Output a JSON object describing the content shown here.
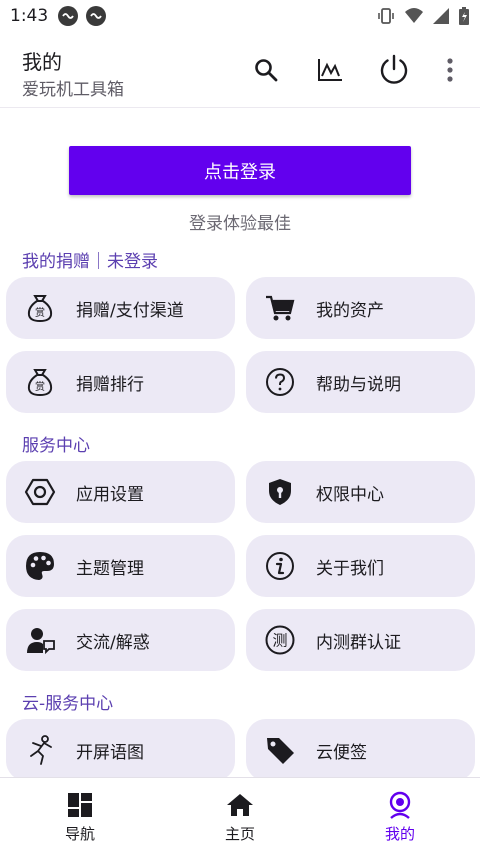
{
  "status_bar": {
    "time": "1:43"
  },
  "app_bar": {
    "title": "我的",
    "subtitle": "爱玩机工具箱",
    "actions": [
      "search-icon",
      "chart-icon",
      "power-icon",
      "more-vert-icon"
    ]
  },
  "login": {
    "button_label": "点击登录",
    "hint": "登录体验最佳",
    "accent_color": "#6200ee"
  },
  "sections": {
    "donate": {
      "title": "我的捐赠｜未登录",
      "items": [
        {
          "label": "捐赠/支付渠道",
          "icon": "money-bag-icon"
        },
        {
          "label": "我的资产",
          "icon": "cart-icon"
        },
        {
          "label": "捐赠排行",
          "icon": "money-bag-icon"
        },
        {
          "label": "帮助与说明",
          "icon": "help-circle-icon"
        }
      ]
    },
    "service": {
      "title": "服务中心",
      "items": [
        {
          "label": "应用设置",
          "icon": "settings-hexagon-icon"
        },
        {
          "label": "权限中心",
          "icon": "shield-icon"
        },
        {
          "label": "主题管理",
          "icon": "palette-icon"
        },
        {
          "label": "关于我们",
          "icon": "info-icon"
        },
        {
          "label": "交流/解惑",
          "icon": "chat-person-icon"
        },
        {
          "label": "内测群认证",
          "icon": "test-badge-icon"
        }
      ]
    },
    "cloud": {
      "title": "云-服务中心",
      "items": [
        {
          "label": "开屏语图",
          "icon": "dancer-icon"
        },
        {
          "label": "云便签",
          "icon": "tag-icon"
        }
      ]
    }
  },
  "bottom_nav": {
    "items": [
      {
        "label": "导航",
        "icon": "dashboard-icon"
      },
      {
        "label": "主页",
        "icon": "home-icon"
      },
      {
        "label": "我的",
        "icon": "profile-icon"
      }
    ],
    "active_index": 2
  },
  "colors": {
    "card_bg": "#ece9f5",
    "section_header": "#5b3fb0"
  }
}
